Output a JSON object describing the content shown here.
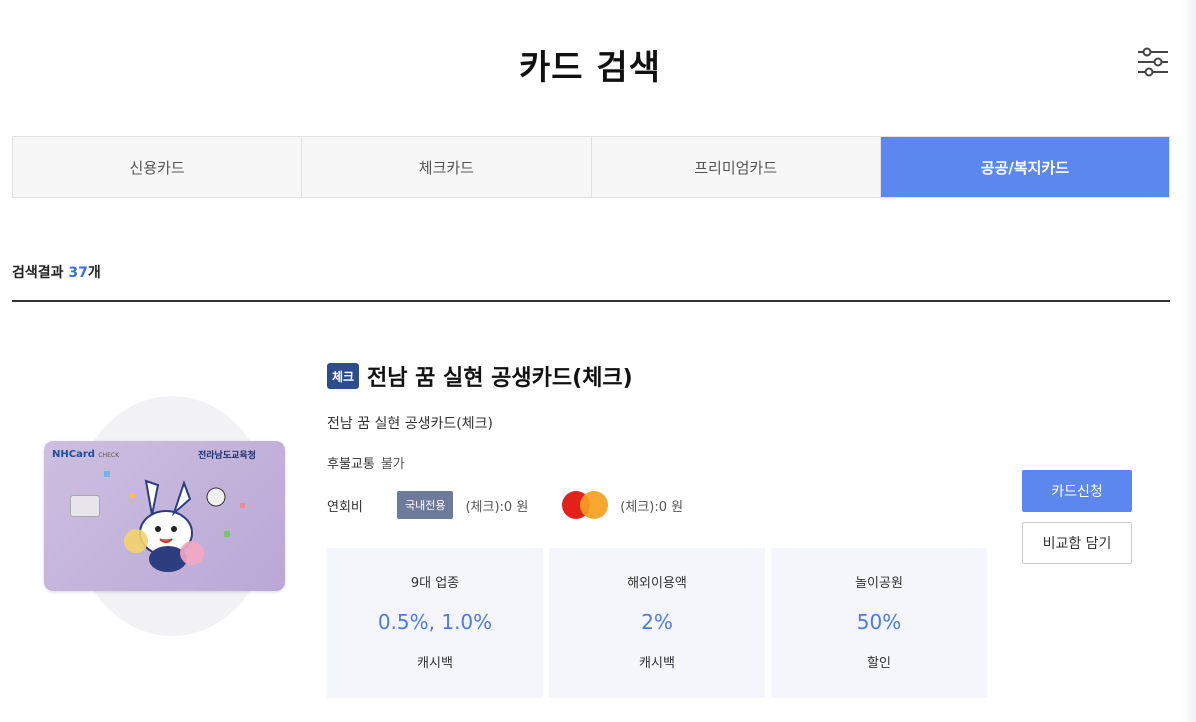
{
  "header": {
    "title": "카드 검색",
    "filter_icon": "sliders-icon"
  },
  "tabs": [
    {
      "label": "신용카드",
      "active": false
    },
    {
      "label": "체크카드",
      "active": false
    },
    {
      "label": "프리미엄카드",
      "active": false
    },
    {
      "label": "공공/복지카드",
      "active": true
    }
  ],
  "results": {
    "label": "검색결과",
    "count": "37",
    "suffix": "개"
  },
  "product": {
    "badge": "체크",
    "title": "전남 꿈 실현 공생카드(체크)",
    "subtitle": "전남 꿈 실현 공생카드(체크)",
    "transit_label": "후불교통",
    "transit_value": "불가",
    "fee_label": "연회비",
    "domestic_badge": "국내전용",
    "domestic_fee": "(체크):0 원",
    "intl_brand_icon": "mastercard-icon",
    "intl_fee": "(체크):0 원",
    "card_image": {
      "brand": "NHCard",
      "brand_sub": "CHECK",
      "issuer": "전라남도교육청"
    },
    "benefits": [
      {
        "name": "9대 업종",
        "value": "0.5%, 1.0%",
        "unit": "캐시백"
      },
      {
        "name": "해외이용액",
        "value": "2%",
        "unit": "캐시백"
      },
      {
        "name": "놀이공원",
        "value": "50%",
        "unit": "할인"
      }
    ],
    "apply_label": "카드신청",
    "compare_label": "비교함 담기"
  },
  "colors": {
    "accent": "#5b87ef",
    "value_text": "#4d7ae8",
    "benefit_bg": "#f4f6fb",
    "badge_bg": "#6e7a99"
  }
}
